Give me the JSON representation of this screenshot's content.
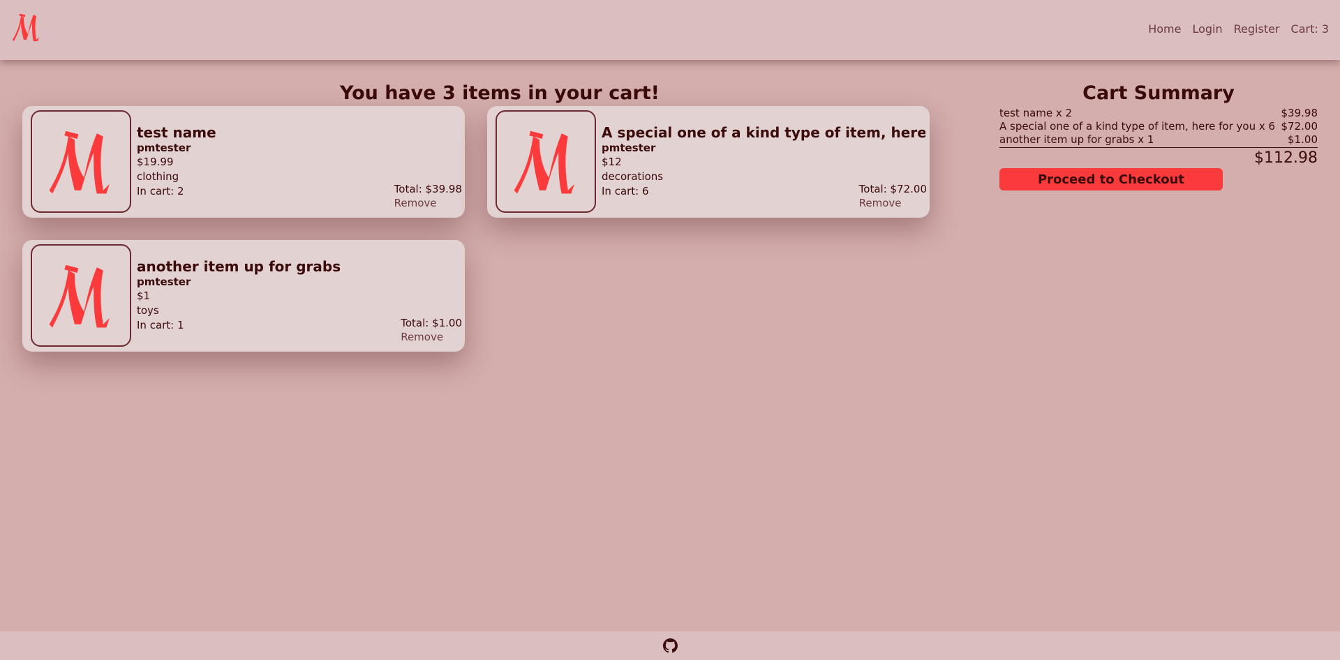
{
  "colors": {
    "accent": "#fb3b3b",
    "text": "#3b0a0a",
    "bg": "#d4adad",
    "card_bg": "#e3d2d2"
  },
  "logo_icon": "logo-m-icon",
  "nav": {
    "home": "Home",
    "login": "Login",
    "register": "Register",
    "cart": "Cart: 3"
  },
  "cart": {
    "heading": "You have 3 items in your cart!",
    "items": [
      {
        "name": "test name",
        "seller": "pmtester",
        "price": "$19.99",
        "category": "clothing",
        "in_cart": "In cart: 2",
        "total": "Total: $39.98",
        "remove": "Remove"
      },
      {
        "name": "A special one of a kind type of item, here for you",
        "seller": "pmtester",
        "price": "$12",
        "category": "decorations",
        "in_cart": "In cart: 6",
        "total": "Total: $72.00",
        "remove": "Remove"
      },
      {
        "name": "another item up for grabs",
        "seller": "pmtester",
        "price": "$1",
        "category": "toys",
        "in_cart": "In cart: 1",
        "total": "Total: $1.00",
        "remove": "Remove"
      }
    ]
  },
  "summary": {
    "title": "Cart Summary",
    "rows": [
      {
        "label": "test name x 2",
        "amount": "$39.98"
      },
      {
        "label": "A special one of a kind type of item, here for you x 6",
        "amount": "$72.00"
      },
      {
        "label": "another item up for grabs x 1",
        "amount": "$1.00"
      }
    ],
    "total": "$112.98",
    "checkout": "Proceed to Checkout"
  },
  "footer": {
    "icon": "github-icon"
  }
}
